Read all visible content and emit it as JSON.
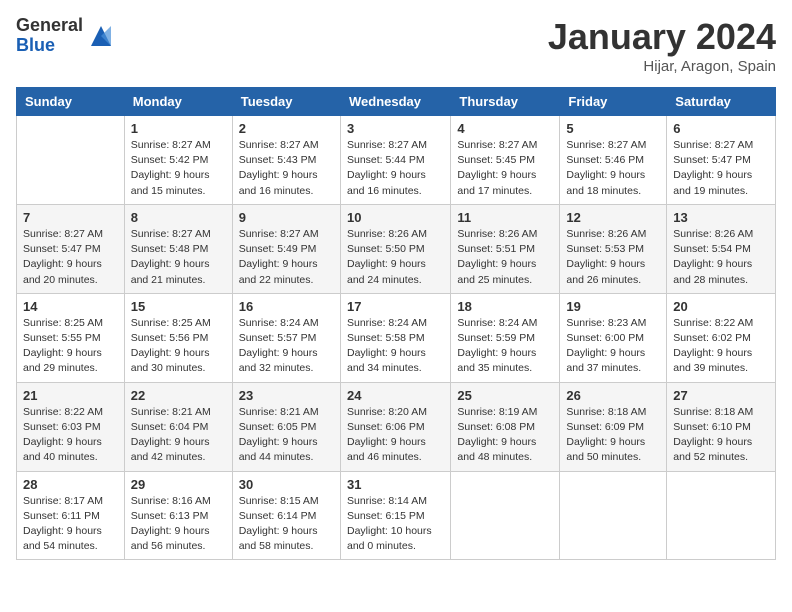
{
  "logo": {
    "general": "General",
    "blue": "Blue"
  },
  "header": {
    "month_year": "January 2024",
    "location": "Hijar, Aragon, Spain"
  },
  "days_of_week": [
    "Sunday",
    "Monday",
    "Tuesday",
    "Wednesday",
    "Thursday",
    "Friday",
    "Saturday"
  ],
  "weeks": [
    [
      {
        "day": "",
        "sunrise": "",
        "sunset": "",
        "daylight": ""
      },
      {
        "day": "1",
        "sunrise": "Sunrise: 8:27 AM",
        "sunset": "Sunset: 5:42 PM",
        "daylight": "Daylight: 9 hours and 15 minutes."
      },
      {
        "day": "2",
        "sunrise": "Sunrise: 8:27 AM",
        "sunset": "Sunset: 5:43 PM",
        "daylight": "Daylight: 9 hours and 16 minutes."
      },
      {
        "day": "3",
        "sunrise": "Sunrise: 8:27 AM",
        "sunset": "Sunset: 5:44 PM",
        "daylight": "Daylight: 9 hours and 16 minutes."
      },
      {
        "day": "4",
        "sunrise": "Sunrise: 8:27 AM",
        "sunset": "Sunset: 5:45 PM",
        "daylight": "Daylight: 9 hours and 17 minutes."
      },
      {
        "day": "5",
        "sunrise": "Sunrise: 8:27 AM",
        "sunset": "Sunset: 5:46 PM",
        "daylight": "Daylight: 9 hours and 18 minutes."
      },
      {
        "day": "6",
        "sunrise": "Sunrise: 8:27 AM",
        "sunset": "Sunset: 5:47 PM",
        "daylight": "Daylight: 9 hours and 19 minutes."
      }
    ],
    [
      {
        "day": "7",
        "sunrise": "Sunrise: 8:27 AM",
        "sunset": "Sunset: 5:47 PM",
        "daylight": "Daylight: 9 hours and 20 minutes."
      },
      {
        "day": "8",
        "sunrise": "Sunrise: 8:27 AM",
        "sunset": "Sunset: 5:48 PM",
        "daylight": "Daylight: 9 hours and 21 minutes."
      },
      {
        "day": "9",
        "sunrise": "Sunrise: 8:27 AM",
        "sunset": "Sunset: 5:49 PM",
        "daylight": "Daylight: 9 hours and 22 minutes."
      },
      {
        "day": "10",
        "sunrise": "Sunrise: 8:26 AM",
        "sunset": "Sunset: 5:50 PM",
        "daylight": "Daylight: 9 hours and 24 minutes."
      },
      {
        "day": "11",
        "sunrise": "Sunrise: 8:26 AM",
        "sunset": "Sunset: 5:51 PM",
        "daylight": "Daylight: 9 hours and 25 minutes."
      },
      {
        "day": "12",
        "sunrise": "Sunrise: 8:26 AM",
        "sunset": "Sunset: 5:53 PM",
        "daylight": "Daylight: 9 hours and 26 minutes."
      },
      {
        "day": "13",
        "sunrise": "Sunrise: 8:26 AM",
        "sunset": "Sunset: 5:54 PM",
        "daylight": "Daylight: 9 hours and 28 minutes."
      }
    ],
    [
      {
        "day": "14",
        "sunrise": "Sunrise: 8:25 AM",
        "sunset": "Sunset: 5:55 PM",
        "daylight": "Daylight: 9 hours and 29 minutes."
      },
      {
        "day": "15",
        "sunrise": "Sunrise: 8:25 AM",
        "sunset": "Sunset: 5:56 PM",
        "daylight": "Daylight: 9 hours and 30 minutes."
      },
      {
        "day": "16",
        "sunrise": "Sunrise: 8:24 AM",
        "sunset": "Sunset: 5:57 PM",
        "daylight": "Daylight: 9 hours and 32 minutes."
      },
      {
        "day": "17",
        "sunrise": "Sunrise: 8:24 AM",
        "sunset": "Sunset: 5:58 PM",
        "daylight": "Daylight: 9 hours and 34 minutes."
      },
      {
        "day": "18",
        "sunrise": "Sunrise: 8:24 AM",
        "sunset": "Sunset: 5:59 PM",
        "daylight": "Daylight: 9 hours and 35 minutes."
      },
      {
        "day": "19",
        "sunrise": "Sunrise: 8:23 AM",
        "sunset": "Sunset: 6:00 PM",
        "daylight": "Daylight: 9 hours and 37 minutes."
      },
      {
        "day": "20",
        "sunrise": "Sunrise: 8:22 AM",
        "sunset": "Sunset: 6:02 PM",
        "daylight": "Daylight: 9 hours and 39 minutes."
      }
    ],
    [
      {
        "day": "21",
        "sunrise": "Sunrise: 8:22 AM",
        "sunset": "Sunset: 6:03 PM",
        "daylight": "Daylight: 9 hours and 40 minutes."
      },
      {
        "day": "22",
        "sunrise": "Sunrise: 8:21 AM",
        "sunset": "Sunset: 6:04 PM",
        "daylight": "Daylight: 9 hours and 42 minutes."
      },
      {
        "day": "23",
        "sunrise": "Sunrise: 8:21 AM",
        "sunset": "Sunset: 6:05 PM",
        "daylight": "Daylight: 9 hours and 44 minutes."
      },
      {
        "day": "24",
        "sunrise": "Sunrise: 8:20 AM",
        "sunset": "Sunset: 6:06 PM",
        "daylight": "Daylight: 9 hours and 46 minutes."
      },
      {
        "day": "25",
        "sunrise": "Sunrise: 8:19 AM",
        "sunset": "Sunset: 6:08 PM",
        "daylight": "Daylight: 9 hours and 48 minutes."
      },
      {
        "day": "26",
        "sunrise": "Sunrise: 8:18 AM",
        "sunset": "Sunset: 6:09 PM",
        "daylight": "Daylight: 9 hours and 50 minutes."
      },
      {
        "day": "27",
        "sunrise": "Sunrise: 8:18 AM",
        "sunset": "Sunset: 6:10 PM",
        "daylight": "Daylight: 9 hours and 52 minutes."
      }
    ],
    [
      {
        "day": "28",
        "sunrise": "Sunrise: 8:17 AM",
        "sunset": "Sunset: 6:11 PM",
        "daylight": "Daylight: 9 hours and 54 minutes."
      },
      {
        "day": "29",
        "sunrise": "Sunrise: 8:16 AM",
        "sunset": "Sunset: 6:13 PM",
        "daylight": "Daylight: 9 hours and 56 minutes."
      },
      {
        "day": "30",
        "sunrise": "Sunrise: 8:15 AM",
        "sunset": "Sunset: 6:14 PM",
        "daylight": "Daylight: 9 hours and 58 minutes."
      },
      {
        "day": "31",
        "sunrise": "Sunrise: 8:14 AM",
        "sunset": "Sunset: 6:15 PM",
        "daylight": "Daylight: 10 hours and 0 minutes."
      },
      {
        "day": "",
        "sunrise": "",
        "sunset": "",
        "daylight": ""
      },
      {
        "day": "",
        "sunrise": "",
        "sunset": "",
        "daylight": ""
      },
      {
        "day": "",
        "sunrise": "",
        "sunset": "",
        "daylight": ""
      }
    ]
  ]
}
